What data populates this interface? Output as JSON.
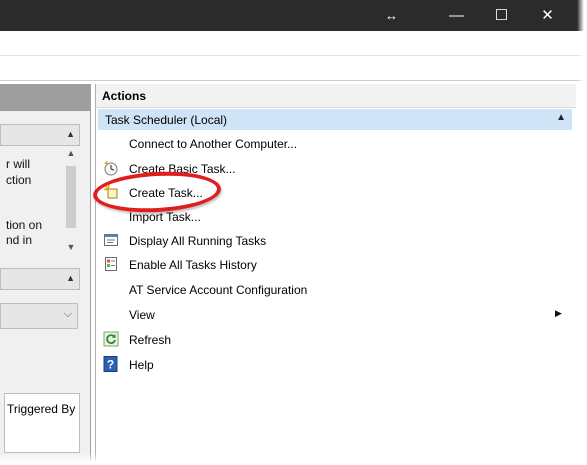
{
  "window": {
    "resize_glyph": "↔",
    "minimize_glyph": "—",
    "maximize_glyph": "☐",
    "close_glyph": "✕"
  },
  "left_pane": {
    "text_lines": [
      "r will",
      "ction",
      "",
      "",
      "tion on",
      "nd in"
    ],
    "column_header": "Triggered By",
    "scroll_up": "▲",
    "scroll_down": "▼",
    "dropdown_caret": "⌵"
  },
  "actions": {
    "header": "Actions",
    "group": "Task Scheduler (Local)",
    "group_caret": "▲",
    "items": [
      {
        "label": "Connect to Another Computer...",
        "icon": "none"
      },
      {
        "label": "Create Basic Task...",
        "icon": "basic-task-icon"
      },
      {
        "label": "Create Task...",
        "icon": "create-task-icon"
      },
      {
        "label": "Import Task...",
        "icon": "none"
      },
      {
        "label": "Display All Running Tasks",
        "icon": "running-tasks-icon"
      },
      {
        "label": "Enable All Tasks History",
        "icon": "tasks-history-icon"
      },
      {
        "label": "AT Service Account Configuration",
        "icon": "none"
      },
      {
        "label": "View",
        "icon": "none",
        "submenu_arrow": "▶"
      },
      {
        "label": "Refresh",
        "icon": "refresh-icon"
      },
      {
        "label": "Help",
        "icon": "help-icon",
        "glyph": "?"
      }
    ]
  },
  "colors": {
    "titlebar": "#2b2b2b",
    "group_highlight": "#cfe4f7",
    "annotation_red": "#e21d1d"
  }
}
